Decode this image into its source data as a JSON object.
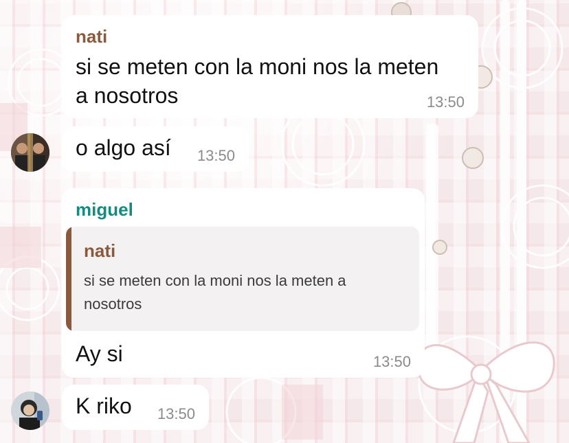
{
  "theme": {
    "nati_color": "#8b5a3c",
    "miguel_color": "#128c7e",
    "bubble_color": "#ffffff",
    "timestamp_color": "#8a8a8f"
  },
  "messages": [
    {
      "sender": "nati",
      "text_line1": "si se meten con la moni nos la meten",
      "text_line2": "a nosotros",
      "time": "13:50"
    },
    {
      "text": "o algo así",
      "time": "13:50",
      "avatar_icon": "user-photo-avatar"
    },
    {
      "sender": "miguel",
      "quote": {
        "sender": "nati",
        "text_line1": "si se meten con la moni nos la meten a",
        "text_line2": "nosotros"
      },
      "text": "Ay si",
      "time": "13:50"
    },
    {
      "text": "K riko",
      "time": "13:50",
      "avatar_icon": "user-photo-avatar"
    }
  ]
}
